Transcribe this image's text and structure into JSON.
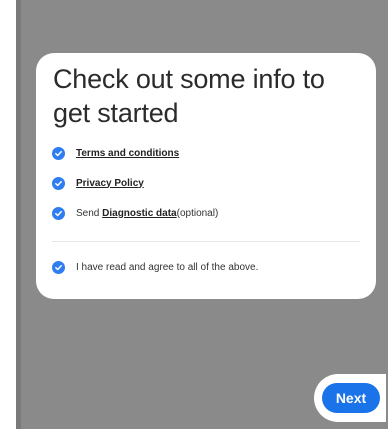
{
  "card": {
    "title": "Check out some info to get started",
    "items": [
      {
        "label": "Terms and conditions",
        "checked": true,
        "icon": "check-circle-icon"
      },
      {
        "label": "Privacy Policy",
        "checked": true,
        "icon": "check-circle-icon"
      },
      {
        "prefix": "Send ",
        "link": "Diagnostic data",
        "suffix": "(optional)",
        "checked": true,
        "icon": "check-circle-icon"
      }
    ],
    "agree_all": {
      "label": "I have read and agree to all of the above.",
      "checked": true,
      "icon": "check-circle-icon"
    }
  },
  "footer": {
    "next_label": "Next"
  },
  "colors": {
    "accent": "#1a73e8",
    "check": "#2f7df0",
    "backdrop": "#8a8a8a"
  }
}
